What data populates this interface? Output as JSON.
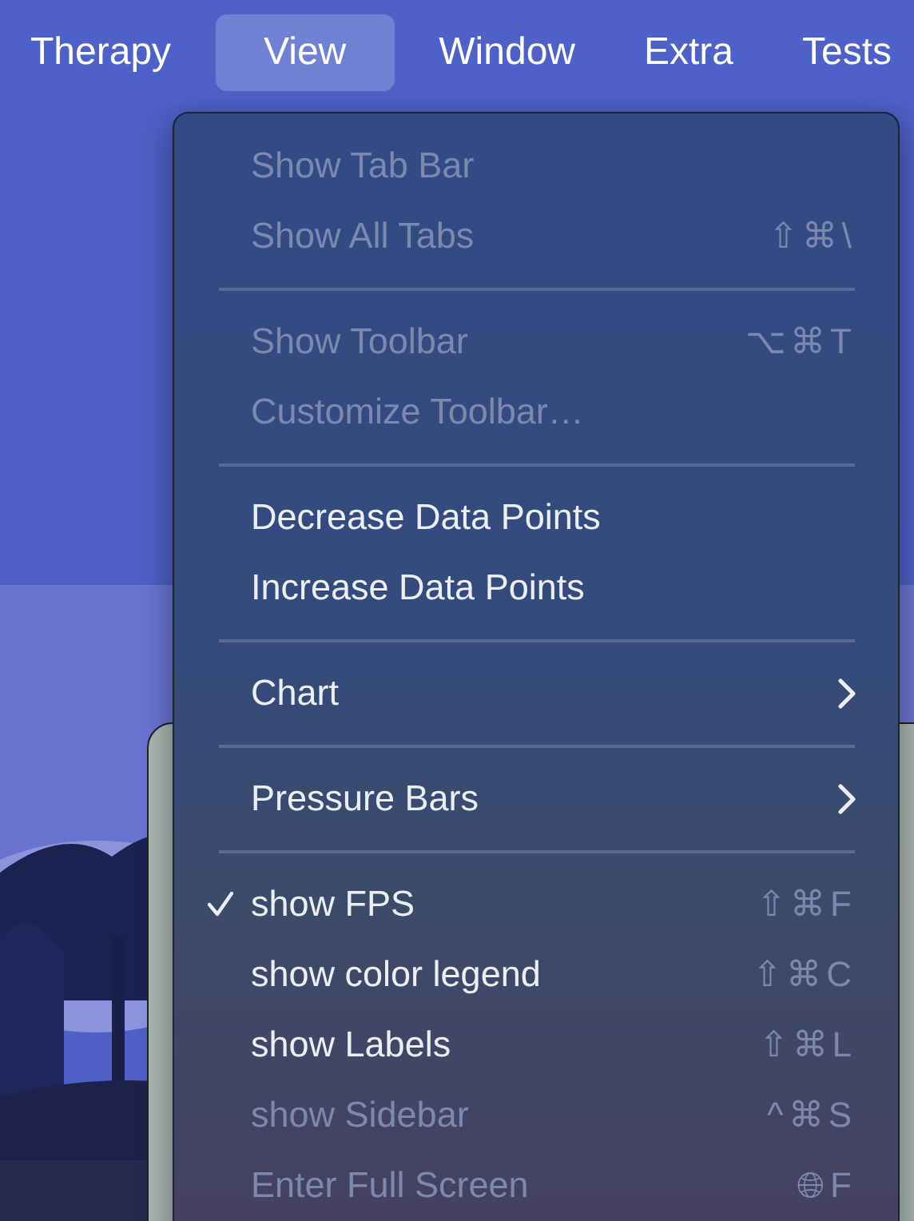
{
  "menu_bar": [
    {
      "label": "Therapy",
      "selected": false
    },
    {
      "label": "View",
      "selected": true
    },
    {
      "label": "Window",
      "selected": false
    },
    {
      "label": "Extra",
      "selected": false
    },
    {
      "label": "Tests",
      "selected": false
    }
  ],
  "menu": {
    "sections": [
      {
        "items": [
          {
            "kind": "command",
            "label": "Show Tab Bar",
            "disabled": true,
            "checked": false
          },
          {
            "kind": "command",
            "label": "Show All Tabs",
            "shortcut": "⇧⌘\\",
            "disabled": true,
            "checked": false
          }
        ]
      },
      {
        "items": [
          {
            "kind": "command",
            "label": "Show Toolbar",
            "shortcut": "⌥⌘T",
            "disabled": true,
            "checked": false
          },
          {
            "kind": "command",
            "label": "Customize Toolbar…",
            "disabled": true,
            "checked": false
          }
        ]
      },
      {
        "items": [
          {
            "kind": "command",
            "label": "Decrease Data Points",
            "disabled": false,
            "checked": false
          },
          {
            "kind": "command",
            "label": "Increase Data Points",
            "disabled": false,
            "checked": false
          }
        ]
      },
      {
        "items": [
          {
            "kind": "submenu",
            "label": "Chart",
            "disabled": false,
            "checked": false
          }
        ]
      },
      {
        "items": [
          {
            "kind": "submenu",
            "label": "Pressure Bars",
            "disabled": false,
            "checked": false
          }
        ]
      },
      {
        "items": [
          {
            "kind": "command",
            "label": "show FPS",
            "shortcut": "⇧⌘F",
            "disabled": false,
            "checked": true
          },
          {
            "kind": "command",
            "label": "show color legend",
            "shortcut": "⇧⌘C",
            "disabled": false,
            "checked": false
          },
          {
            "kind": "command",
            "label": "show Labels",
            "shortcut": "⇧⌘L",
            "disabled": false,
            "checked": false
          },
          {
            "kind": "command",
            "label": "show Sidebar",
            "shortcut": "^⌘S",
            "disabled": true,
            "checked": false
          },
          {
            "kind": "command",
            "label": "Enter Full Screen",
            "shortcut": "🌐︎F",
            "disabled": true,
            "checked": false
          }
        ]
      }
    ]
  }
}
